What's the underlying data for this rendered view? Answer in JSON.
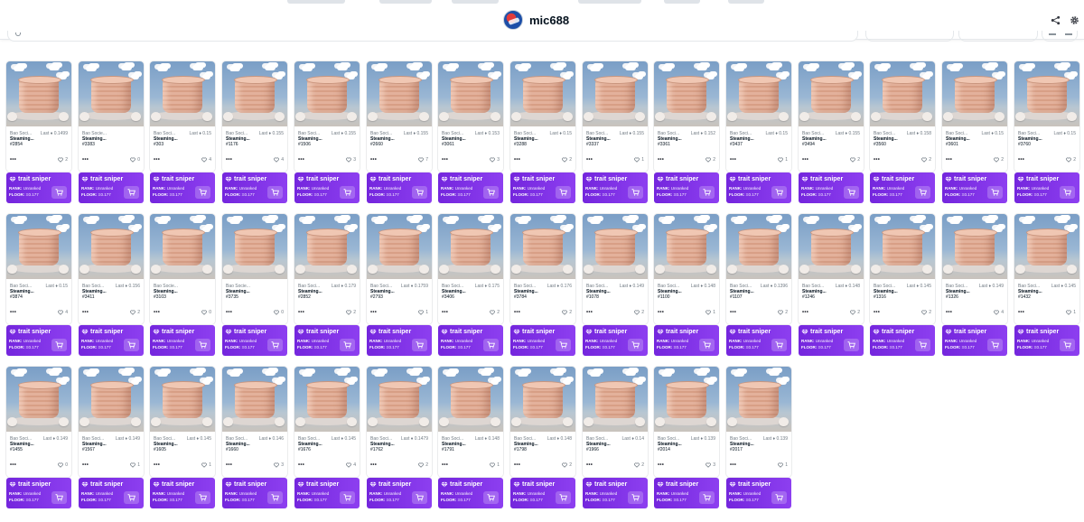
{
  "header": {
    "username": "mic688",
    "avatar_icon": "avatar-icon",
    "share_icon": "share-icon",
    "settings_icon": "gear-icon"
  },
  "colors": {
    "sniper_purple": "#7426dd",
    "sniper_purple_light": "#8d3ff0",
    "border": "#e5e8eb",
    "text_primary": "#04111d",
    "text_secondary": "#707a83"
  },
  "sniper": {
    "label": "trait sniper",
    "rank_label": "RANK:",
    "rank_value": "Unranked",
    "floor_label": "FLOOR:",
    "floor_value": "Ξ0.177",
    "gem_icon": "gem-icon",
    "cart_icon": "cart-icon"
  },
  "cards": [
    {
      "collection": "Bao Soci...",
      "last": "Last ♦ 0.1499",
      "name": "Steaming...",
      "token": "#2854",
      "favorites": "2"
    },
    {
      "collection": "Bao Socie...",
      "last": "",
      "name": "Steaming...",
      "token": "#3383",
      "favorites": "0"
    },
    {
      "collection": "Bao Soci...",
      "last": "Last ♦ 0.15",
      "name": "Steaming...",
      "token": "#303",
      "favorites": "4"
    },
    {
      "collection": "Bao Soci...",
      "last": "Last ♦ 0.155",
      "name": "Steaming...",
      "token": "#1176",
      "favorites": "4"
    },
    {
      "collection": "Bao Soci...",
      "last": "Last ♦ 0.155",
      "name": "Steaming...",
      "token": "#1506",
      "favorites": "3"
    },
    {
      "collection": "Bao Soci...",
      "last": "Last ♦ 0.155",
      "name": "Steaming...",
      "token": "#2660",
      "favorites": "7"
    },
    {
      "collection": "Bao Soci...",
      "last": "Last ♦ 0.153",
      "name": "Steaming...",
      "token": "#3061",
      "favorites": "3"
    },
    {
      "collection": "Bao Soci...",
      "last": "Last ♦ 0.15",
      "name": "Steaming...",
      "token": "#3288",
      "favorites": "2"
    },
    {
      "collection": "Bao Soci...",
      "last": "Last ♦ 0.155",
      "name": "Steaming...",
      "token": "#3337",
      "favorites": "1"
    },
    {
      "collection": "Bao Soci...",
      "last": "Last ♦ 0.152",
      "name": "Steaming...",
      "token": "#3361",
      "favorites": "2"
    },
    {
      "collection": "Bao Soci...",
      "last": "Last ♦ 0.15",
      "name": "Steaming...",
      "token": "#3437",
      "favorites": "1"
    },
    {
      "collection": "Bao Soci...",
      "last": "Last ♦ 0.155",
      "name": "Steaming...",
      "token": "#3494",
      "favorites": "2"
    },
    {
      "collection": "Bao Soci...",
      "last": "Last ♦ 0.158",
      "name": "Steaming...",
      "token": "#3560",
      "favorites": "2"
    },
    {
      "collection": "Bao Soci...",
      "last": "Last ♦ 0.15",
      "name": "Steaming...",
      "token": "#3601",
      "favorites": "2"
    },
    {
      "collection": "Bao Soci...",
      "last": "Last ♦ 0.15",
      "name": "Steaming...",
      "token": "#3760",
      "favorites": "2"
    },
    {
      "collection": "Bao Soci...",
      "last": "Last ♦ 0.15",
      "name": "Steaming...",
      "token": "#3874",
      "favorites": "4"
    },
    {
      "collection": "Bao Soci...",
      "last": "Last ♦ 0.156",
      "name": "Steaming...",
      "token": "#3411",
      "favorites": "2"
    },
    {
      "collection": "Bao Socie...",
      "last": "",
      "name": "Steaming...",
      "token": "#3103",
      "favorites": "0"
    },
    {
      "collection": "Bao Socie...",
      "last": "",
      "name": "Steaming...",
      "token": "#3735",
      "favorites": "0"
    },
    {
      "collection": "Bao Soci...",
      "last": "Last ♦ 0.179",
      "name": "Steaming...",
      "token": "#2852",
      "favorites": "2"
    },
    {
      "collection": "Bao Soci...",
      "last": "Last ♦ 0.1759",
      "name": "Steaming...",
      "token": "#2793",
      "favorites": "1"
    },
    {
      "collection": "Bao Soci...",
      "last": "Last ♦ 0.175",
      "name": "Steaming...",
      "token": "#3406",
      "favorites": "2"
    },
    {
      "collection": "Bao Soci...",
      "last": "Last ♦ 0.176",
      "name": "Steaming...",
      "token": "#3784",
      "favorites": "2"
    },
    {
      "collection": "Bao Soci...",
      "last": "Last ♦ 0.149",
      "name": "Steaming...",
      "token": "#1078",
      "favorites": "2"
    },
    {
      "collection": "Bao Soci...",
      "last": "Last ♦ 0.148",
      "name": "Steaming...",
      "token": "#1100",
      "favorites": "1"
    },
    {
      "collection": "Bao Soci...",
      "last": "Last ♦ 0.1396",
      "name": "Steaming...",
      "token": "#1107",
      "favorites": "2"
    },
    {
      "collection": "Bao Soci...",
      "last": "Last ♦ 0.148",
      "name": "Steaming...",
      "token": "#1246",
      "favorites": "2"
    },
    {
      "collection": "Bao Soci...",
      "last": "Last ♦ 0.145",
      "name": "Steaming...",
      "token": "#1316",
      "favorites": "2"
    },
    {
      "collection": "Bao Soci...",
      "last": "Last ♦ 0.149",
      "name": "Steaming...",
      "token": "#1326",
      "favorites": "4"
    },
    {
      "collection": "Bao Soci...",
      "last": "Last ♦ 0.145",
      "name": "Steaming...",
      "token": "#1432",
      "favorites": "1"
    },
    {
      "collection": "Bao Soci...",
      "last": "Last ♦ 0.149",
      "name": "Steaming...",
      "token": "#1455",
      "favorites": "0"
    },
    {
      "collection": "Bao Soci...",
      "last": "Last ♦ 0.149",
      "name": "Steaming...",
      "token": "#1567",
      "favorites": "1"
    },
    {
      "collection": "Bao Soci...",
      "last": "Last ♦ 0.145",
      "name": "Steaming...",
      "token": "#1605",
      "favorites": "1"
    },
    {
      "collection": "Bao Soci...",
      "last": "Last ♦ 0.146",
      "name": "Steaming...",
      "token": "#1660",
      "favorites": "3"
    },
    {
      "collection": "Bao Soci...",
      "last": "Last ♦ 0.145",
      "name": "Steaming...",
      "token": "#1676",
      "favorites": "4"
    },
    {
      "collection": "Bao Soci...",
      "last": "Last ♦ 0.1479",
      "name": "Steaming...",
      "token": "#1762",
      "favorites": "2"
    },
    {
      "collection": "Bao Soci...",
      "last": "Last ♦ 0.148",
      "name": "Steaming...",
      "token": "#1791",
      "favorites": "1"
    },
    {
      "collection": "Bao Soci...",
      "last": "Last ♦ 0.148",
      "name": "Steaming...",
      "token": "#1798",
      "favorites": "2"
    },
    {
      "collection": "Bao Soci...",
      "last": "Last ♦ 0.14",
      "name": "Steaming...",
      "token": "#1966",
      "favorites": "2"
    },
    {
      "collection": "Bao Soci...",
      "last": "Last ♦ 0.139",
      "name": "Steaming...",
      "token": "#2014",
      "favorites": "3"
    },
    {
      "collection": "Bao Soci...",
      "last": "Last ♦ 0.139",
      "name": "Steaming...",
      "token": "#2017",
      "favorites": "1"
    }
  ]
}
